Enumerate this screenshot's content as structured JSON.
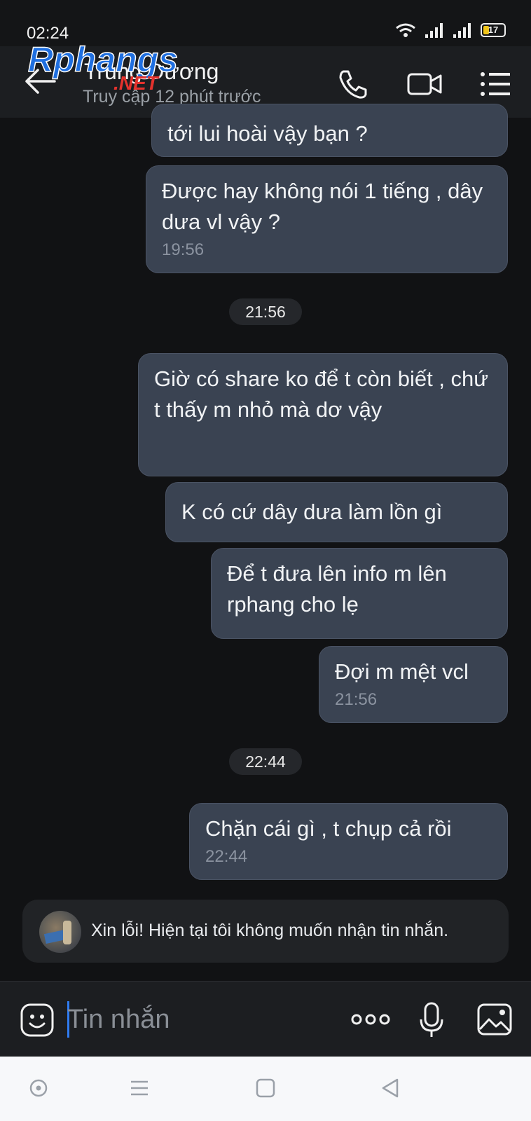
{
  "status_bar": {
    "time": "02:24",
    "battery": "17"
  },
  "header": {
    "contact_name": "Trung Dương",
    "contact_status": "Truy cập 12 phút trước",
    "watermark_main": "Rphangs",
    "watermark_sub": ".NET"
  },
  "messages": [
    {
      "text": "tới lui hoài vậy bạn ?",
      "time": ""
    },
    {
      "text": "Được hay không nói 1 tiếng , dây dưa vl vậy ?",
      "time": "19:56"
    },
    {
      "text": "Giờ có share ko để t còn biết , chứ t thấy m nhỏ mà dơ vậy",
      "time": ""
    },
    {
      "text": "K có cứ dây dưa làm lồn gì",
      "time": ""
    },
    {
      "text": "Để t đưa lên info m lên rphang cho lẹ",
      "time": ""
    },
    {
      "text": "Đợi m mệt vcl",
      "time": "21:56"
    },
    {
      "text": "Chặn cái gì , t chụp cả rồi",
      "time": "22:44"
    }
  ],
  "time_separators": [
    "21:56",
    "22:44"
  ],
  "notice": {
    "text": "Xin lỗi! Hiện tại tôi không muốn nhận tin nhắn."
  },
  "composer": {
    "placeholder": "Tin nhắn"
  },
  "colors": {
    "background": "#111214",
    "bubble": "#3a4352",
    "header": "#1c1e21",
    "accent_cursor": "#2f7bf0",
    "nav_bar": "#f7f8fa"
  },
  "icons": {
    "back": "arrow-left-icon",
    "call": "phone-icon",
    "video": "video-camera-icon",
    "menu": "list-menu-icon",
    "emoji": "sticker-icon",
    "more": "more-dots-icon",
    "mic": "microphone-icon",
    "image": "gallery-icon"
  }
}
